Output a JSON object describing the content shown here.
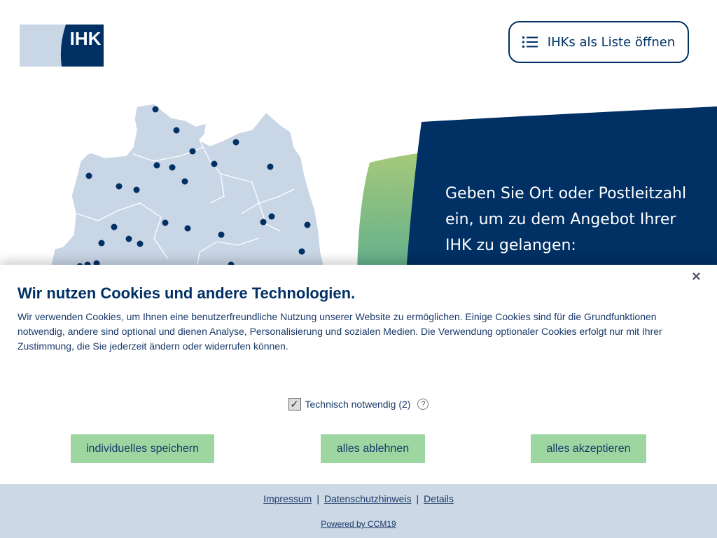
{
  "header": {
    "logo_text": "IHK",
    "list_button_label": "IHKs als Liste öffnen"
  },
  "hero": {
    "prompt_text": "Geben Sie Ort oder Postleitzahl ein, um zu dem Angebot Ihrer IHK zu gelangen:"
  },
  "colors": {
    "brand_navy": "#003064",
    "brand_green": "#9dd6a1",
    "map_fill": "#c9d6e6",
    "footer_bg": "#cdd8e5"
  },
  "cookie_banner": {
    "close_symbol": "×",
    "title": "Wir nutzen Cookies und andere Technologien.",
    "text": "Wir verwenden Cookies, um Ihnen eine benutzerfreundliche Nutzung unserer Website zu ermöglichen. Einige Cookies sind für die Grundfunktionen notwendig, andere sind optional und dienen Analyse, Personalisierung und sozialen Medien. Die Verwendung optionaler Cookies erfolgt nur mit Ihrer Zustimmung, die Sie jederzeit ändern oder widerrufen können.",
    "category_label": "Technisch notwendig (2)",
    "category_checked": true,
    "check_symbol": "✓",
    "help_symbol": "?",
    "buttons": {
      "save_individual": "individuelles speichern",
      "reject_all": "alles ablehnen",
      "accept_all": "alles akzeptieren"
    },
    "footer": {
      "links": [
        "Impressum",
        "Datenschutzhinweis",
        "Details"
      ],
      "separator": "|",
      "powered_by": "Powered by CCM19"
    }
  }
}
